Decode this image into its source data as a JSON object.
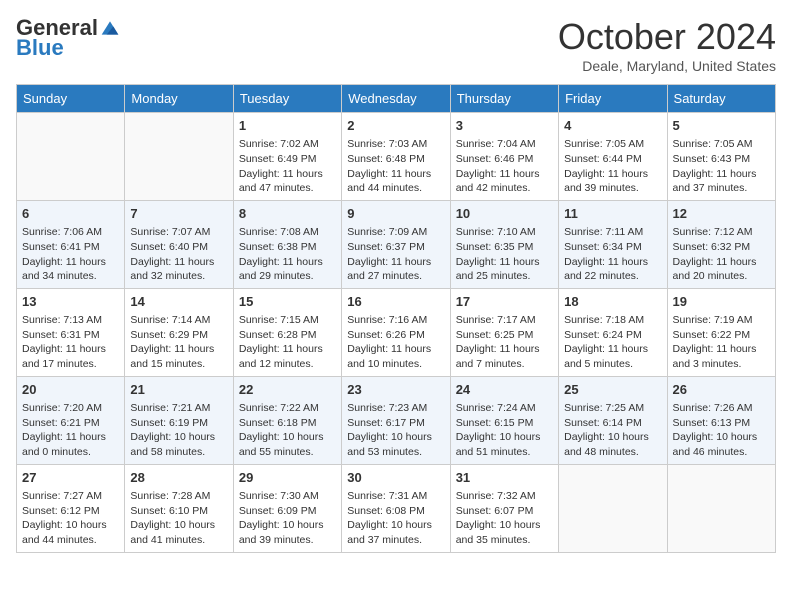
{
  "header": {
    "logo_general": "General",
    "logo_blue": "Blue",
    "month_title": "October 2024",
    "location": "Deale, Maryland, United States"
  },
  "days_of_week": [
    "Sunday",
    "Monday",
    "Tuesday",
    "Wednesday",
    "Thursday",
    "Friday",
    "Saturday"
  ],
  "weeks": [
    [
      {
        "day": "",
        "content": ""
      },
      {
        "day": "",
        "content": ""
      },
      {
        "day": "1",
        "content": "Sunrise: 7:02 AM\nSunset: 6:49 PM\nDaylight: 11 hours and 47 minutes."
      },
      {
        "day": "2",
        "content": "Sunrise: 7:03 AM\nSunset: 6:48 PM\nDaylight: 11 hours and 44 minutes."
      },
      {
        "day": "3",
        "content": "Sunrise: 7:04 AM\nSunset: 6:46 PM\nDaylight: 11 hours and 42 minutes."
      },
      {
        "day": "4",
        "content": "Sunrise: 7:05 AM\nSunset: 6:44 PM\nDaylight: 11 hours and 39 minutes."
      },
      {
        "day": "5",
        "content": "Sunrise: 7:05 AM\nSunset: 6:43 PM\nDaylight: 11 hours and 37 minutes."
      }
    ],
    [
      {
        "day": "6",
        "content": "Sunrise: 7:06 AM\nSunset: 6:41 PM\nDaylight: 11 hours and 34 minutes."
      },
      {
        "day": "7",
        "content": "Sunrise: 7:07 AM\nSunset: 6:40 PM\nDaylight: 11 hours and 32 minutes."
      },
      {
        "day": "8",
        "content": "Sunrise: 7:08 AM\nSunset: 6:38 PM\nDaylight: 11 hours and 29 minutes."
      },
      {
        "day": "9",
        "content": "Sunrise: 7:09 AM\nSunset: 6:37 PM\nDaylight: 11 hours and 27 minutes."
      },
      {
        "day": "10",
        "content": "Sunrise: 7:10 AM\nSunset: 6:35 PM\nDaylight: 11 hours and 25 minutes."
      },
      {
        "day": "11",
        "content": "Sunrise: 7:11 AM\nSunset: 6:34 PM\nDaylight: 11 hours and 22 minutes."
      },
      {
        "day": "12",
        "content": "Sunrise: 7:12 AM\nSunset: 6:32 PM\nDaylight: 11 hours and 20 minutes."
      }
    ],
    [
      {
        "day": "13",
        "content": "Sunrise: 7:13 AM\nSunset: 6:31 PM\nDaylight: 11 hours and 17 minutes."
      },
      {
        "day": "14",
        "content": "Sunrise: 7:14 AM\nSunset: 6:29 PM\nDaylight: 11 hours and 15 minutes."
      },
      {
        "day": "15",
        "content": "Sunrise: 7:15 AM\nSunset: 6:28 PM\nDaylight: 11 hours and 12 minutes."
      },
      {
        "day": "16",
        "content": "Sunrise: 7:16 AM\nSunset: 6:26 PM\nDaylight: 11 hours and 10 minutes."
      },
      {
        "day": "17",
        "content": "Sunrise: 7:17 AM\nSunset: 6:25 PM\nDaylight: 11 hours and 7 minutes."
      },
      {
        "day": "18",
        "content": "Sunrise: 7:18 AM\nSunset: 6:24 PM\nDaylight: 11 hours and 5 minutes."
      },
      {
        "day": "19",
        "content": "Sunrise: 7:19 AM\nSunset: 6:22 PM\nDaylight: 11 hours and 3 minutes."
      }
    ],
    [
      {
        "day": "20",
        "content": "Sunrise: 7:20 AM\nSunset: 6:21 PM\nDaylight: 11 hours and 0 minutes."
      },
      {
        "day": "21",
        "content": "Sunrise: 7:21 AM\nSunset: 6:19 PM\nDaylight: 10 hours and 58 minutes."
      },
      {
        "day": "22",
        "content": "Sunrise: 7:22 AM\nSunset: 6:18 PM\nDaylight: 10 hours and 55 minutes."
      },
      {
        "day": "23",
        "content": "Sunrise: 7:23 AM\nSunset: 6:17 PM\nDaylight: 10 hours and 53 minutes."
      },
      {
        "day": "24",
        "content": "Sunrise: 7:24 AM\nSunset: 6:15 PM\nDaylight: 10 hours and 51 minutes."
      },
      {
        "day": "25",
        "content": "Sunrise: 7:25 AM\nSunset: 6:14 PM\nDaylight: 10 hours and 48 minutes."
      },
      {
        "day": "26",
        "content": "Sunrise: 7:26 AM\nSunset: 6:13 PM\nDaylight: 10 hours and 46 minutes."
      }
    ],
    [
      {
        "day": "27",
        "content": "Sunrise: 7:27 AM\nSunset: 6:12 PM\nDaylight: 10 hours and 44 minutes."
      },
      {
        "day": "28",
        "content": "Sunrise: 7:28 AM\nSunset: 6:10 PM\nDaylight: 10 hours and 41 minutes."
      },
      {
        "day": "29",
        "content": "Sunrise: 7:30 AM\nSunset: 6:09 PM\nDaylight: 10 hours and 39 minutes."
      },
      {
        "day": "30",
        "content": "Sunrise: 7:31 AM\nSunset: 6:08 PM\nDaylight: 10 hours and 37 minutes."
      },
      {
        "day": "31",
        "content": "Sunrise: 7:32 AM\nSunset: 6:07 PM\nDaylight: 10 hours and 35 minutes."
      },
      {
        "day": "",
        "content": ""
      },
      {
        "day": "",
        "content": ""
      }
    ]
  ]
}
